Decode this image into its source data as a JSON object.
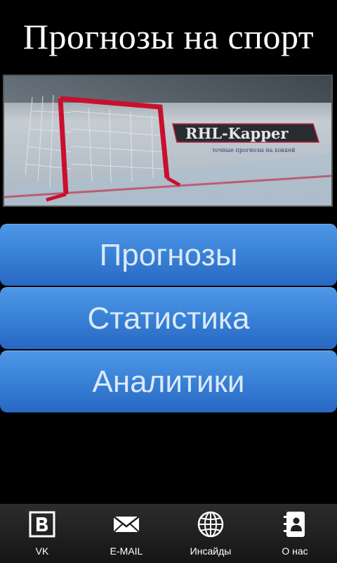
{
  "header": {
    "title": "Прогнозы на спорт"
  },
  "banner": {
    "brand": "RHL-Kapper",
    "tagline": "точные прогнозы на хоккей"
  },
  "menu": {
    "items": [
      {
        "label": "Прогнозы"
      },
      {
        "label": "Статистика"
      },
      {
        "label": "Аналитики"
      }
    ]
  },
  "tabbar": {
    "items": [
      {
        "label": "VK",
        "icon": "vk-icon"
      },
      {
        "label": "E-MAIL",
        "icon": "mail-icon"
      },
      {
        "label": "Инсайды",
        "icon": "globe-icon"
      },
      {
        "label": "О нас",
        "icon": "contacts-icon"
      }
    ]
  },
  "colors": {
    "button": "#3a83d8",
    "background": "#000000",
    "goal_frame": "#c8102e"
  }
}
